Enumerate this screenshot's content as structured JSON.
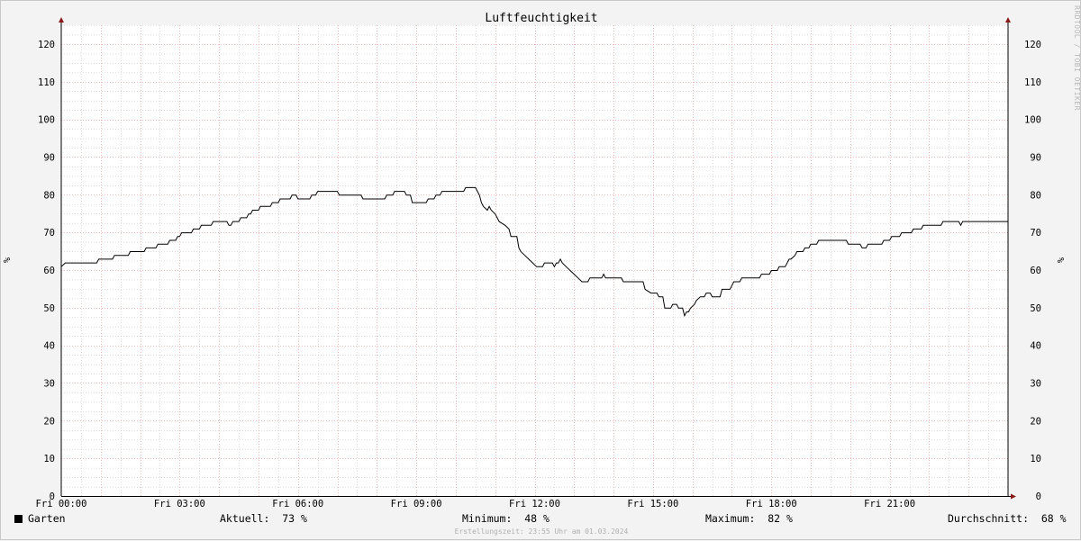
{
  "chart_data": {
    "type": "line",
    "title": "Luftfeuchtigkeit",
    "ylabel": "%",
    "ylim": [
      0,
      125
    ],
    "yticks": [
      0,
      10,
      20,
      30,
      40,
      50,
      60,
      70,
      80,
      90,
      100,
      110,
      120
    ],
    "xlim": [
      0,
      24
    ],
    "xticks": [
      {
        "h": 0,
        "label": "Fri 00:00"
      },
      {
        "h": 3,
        "label": "Fri 03:00"
      },
      {
        "h": 6,
        "label": "Fri 06:00"
      },
      {
        "h": 9,
        "label": "Fri 09:00"
      },
      {
        "h": 12,
        "label": "Fri 12:00"
      },
      {
        "h": 15,
        "label": "Fri 15:00"
      },
      {
        "h": 18,
        "label": "Fri 18:00"
      },
      {
        "h": 21,
        "label": "Fri 21:00"
      }
    ],
    "grid": true,
    "series": [
      {
        "name": "Garten",
        "color": "#000000",
        "points": [
          [
            0.0,
            61
          ],
          [
            0.1,
            62
          ],
          [
            0.9,
            62
          ],
          [
            0.95,
            63
          ],
          [
            1.3,
            63
          ],
          [
            1.35,
            64
          ],
          [
            1.7,
            64
          ],
          [
            1.75,
            65
          ],
          [
            2.1,
            65
          ],
          [
            2.15,
            66
          ],
          [
            2.4,
            66
          ],
          [
            2.45,
            67
          ],
          [
            2.7,
            67
          ],
          [
            2.75,
            68
          ],
          [
            2.9,
            68
          ],
          [
            2.95,
            69
          ],
          [
            3.0,
            69
          ],
          [
            3.05,
            70
          ],
          [
            3.3,
            70
          ],
          [
            3.35,
            71
          ],
          [
            3.5,
            71
          ],
          [
            3.55,
            72
          ],
          [
            3.8,
            72
          ],
          [
            3.85,
            73
          ],
          [
            4.2,
            73
          ],
          [
            4.25,
            72
          ],
          [
            4.3,
            72
          ],
          [
            4.35,
            73
          ],
          [
            4.5,
            73
          ],
          [
            4.55,
            74
          ],
          [
            4.7,
            74
          ],
          [
            4.75,
            75
          ],
          [
            4.8,
            75
          ],
          [
            4.85,
            76
          ],
          [
            5.0,
            76
          ],
          [
            5.05,
            77
          ],
          [
            5.3,
            77
          ],
          [
            5.35,
            78
          ],
          [
            5.5,
            78
          ],
          [
            5.55,
            79
          ],
          [
            5.8,
            79
          ],
          [
            5.85,
            80
          ],
          [
            5.95,
            80
          ],
          [
            6.0,
            79
          ],
          [
            6.3,
            79
          ],
          [
            6.35,
            80
          ],
          [
            6.45,
            80
          ],
          [
            6.5,
            81
          ],
          [
            7.0,
            81
          ],
          [
            7.05,
            80
          ],
          [
            7.6,
            80
          ],
          [
            7.65,
            79
          ],
          [
            8.2,
            79
          ],
          [
            8.25,
            80
          ],
          [
            8.4,
            80
          ],
          [
            8.45,
            81
          ],
          [
            8.7,
            81
          ],
          [
            8.75,
            80
          ],
          [
            8.85,
            80
          ],
          [
            8.9,
            78
          ],
          [
            9.25,
            78
          ],
          [
            9.3,
            79
          ],
          [
            9.45,
            79
          ],
          [
            9.5,
            80
          ],
          [
            9.6,
            80
          ],
          [
            9.65,
            81
          ],
          [
            10.2,
            81
          ],
          [
            10.25,
            82
          ],
          [
            10.5,
            82
          ],
          [
            10.55,
            81
          ],
          [
            10.6,
            80
          ],
          [
            10.65,
            78
          ],
          [
            10.7,
            77
          ],
          [
            10.8,
            76
          ],
          [
            10.85,
            77
          ],
          [
            10.9,
            76
          ],
          [
            11.0,
            75
          ],
          [
            11.05,
            74
          ],
          [
            11.1,
            73
          ],
          [
            11.25,
            72
          ],
          [
            11.35,
            71
          ],
          [
            11.4,
            69
          ],
          [
            11.55,
            69
          ],
          [
            11.6,
            66
          ],
          [
            11.65,
            65
          ],
          [
            11.75,
            64
          ],
          [
            11.85,
            63
          ],
          [
            11.95,
            62
          ],
          [
            12.05,
            61
          ],
          [
            12.2,
            61
          ],
          [
            12.25,
            62
          ],
          [
            12.45,
            62
          ],
          [
            12.5,
            61
          ],
          [
            12.55,
            62
          ],
          [
            12.6,
            62
          ],
          [
            12.65,
            63
          ],
          [
            12.7,
            62
          ],
          [
            12.8,
            61
          ],
          [
            12.9,
            60
          ],
          [
            13.0,
            59
          ],
          [
            13.1,
            58
          ],
          [
            13.2,
            57
          ],
          [
            13.35,
            57
          ],
          [
            13.4,
            58
          ],
          [
            13.7,
            58
          ],
          [
            13.75,
            59
          ],
          [
            13.8,
            58
          ],
          [
            14.2,
            58
          ],
          [
            14.25,
            57
          ],
          [
            14.75,
            57
          ],
          [
            14.8,
            55
          ],
          [
            14.95,
            54
          ],
          [
            15.1,
            54
          ],
          [
            15.15,
            53
          ],
          [
            15.25,
            53
          ],
          [
            15.3,
            50
          ],
          [
            15.45,
            50
          ],
          [
            15.5,
            51
          ],
          [
            15.6,
            51
          ],
          [
            15.65,
            50
          ],
          [
            15.75,
            50
          ],
          [
            15.8,
            48
          ],
          [
            15.85,
            49
          ],
          [
            15.9,
            49
          ],
          [
            15.95,
            50
          ],
          [
            16.05,
            51
          ],
          [
            16.1,
            52
          ],
          [
            16.2,
            53
          ],
          [
            16.3,
            53
          ],
          [
            16.35,
            54
          ],
          [
            16.45,
            54
          ],
          [
            16.5,
            53
          ],
          [
            16.7,
            53
          ],
          [
            16.75,
            55
          ],
          [
            16.95,
            55
          ],
          [
            17.0,
            56
          ],
          [
            17.05,
            57
          ],
          [
            17.2,
            57
          ],
          [
            17.25,
            58
          ],
          [
            17.7,
            58
          ],
          [
            17.75,
            59
          ],
          [
            17.95,
            59
          ],
          [
            18.0,
            60
          ],
          [
            18.15,
            60
          ],
          [
            18.2,
            61
          ],
          [
            18.35,
            61
          ],
          [
            18.4,
            62
          ],
          [
            18.45,
            63
          ],
          [
            18.5,
            63
          ],
          [
            18.6,
            64
          ],
          [
            18.65,
            65
          ],
          [
            18.8,
            65
          ],
          [
            18.85,
            66
          ],
          [
            18.95,
            66
          ],
          [
            19.0,
            67
          ],
          [
            19.15,
            67
          ],
          [
            19.2,
            68
          ],
          [
            19.4,
            68
          ],
          [
            19.45,
            68
          ],
          [
            19.9,
            68
          ],
          [
            19.95,
            67
          ],
          [
            20.25,
            67
          ],
          [
            20.3,
            66
          ],
          [
            20.4,
            66
          ],
          [
            20.45,
            67
          ],
          [
            20.8,
            67
          ],
          [
            20.85,
            68
          ],
          [
            21.0,
            68
          ],
          [
            21.05,
            69
          ],
          [
            21.25,
            69
          ],
          [
            21.3,
            70
          ],
          [
            21.55,
            70
          ],
          [
            21.6,
            71
          ],
          [
            21.8,
            71
          ],
          [
            21.85,
            72
          ],
          [
            22.3,
            72
          ],
          [
            22.35,
            73
          ],
          [
            22.75,
            73
          ],
          [
            22.8,
            72
          ],
          [
            22.85,
            73
          ],
          [
            24.0,
            73
          ]
        ]
      }
    ]
  },
  "legend": {
    "series_name": "Garten",
    "aktuell_label": "Aktuell:",
    "aktuell_value": "73 %",
    "minimum_label": "Minimum:",
    "minimum_value": "48 %",
    "maximum_label": "Maximum:",
    "maximum_value": "82 %",
    "durchschnitt_label": "Durchschnitt:",
    "durchschnitt_value": "68 %"
  },
  "footer": "Erstellungszeit: 23:55 Uhr am 01.03.2024",
  "watermark": "RRDTOOL / TOBI OETIKER",
  "colors": {
    "background": "#f3f3f3",
    "plot_background": "#ffffff",
    "minor_grid": "#c8c8c8",
    "major_grid": "#e8a8a8",
    "line": "#000000",
    "axis_arrow": "#8b1a1a"
  }
}
